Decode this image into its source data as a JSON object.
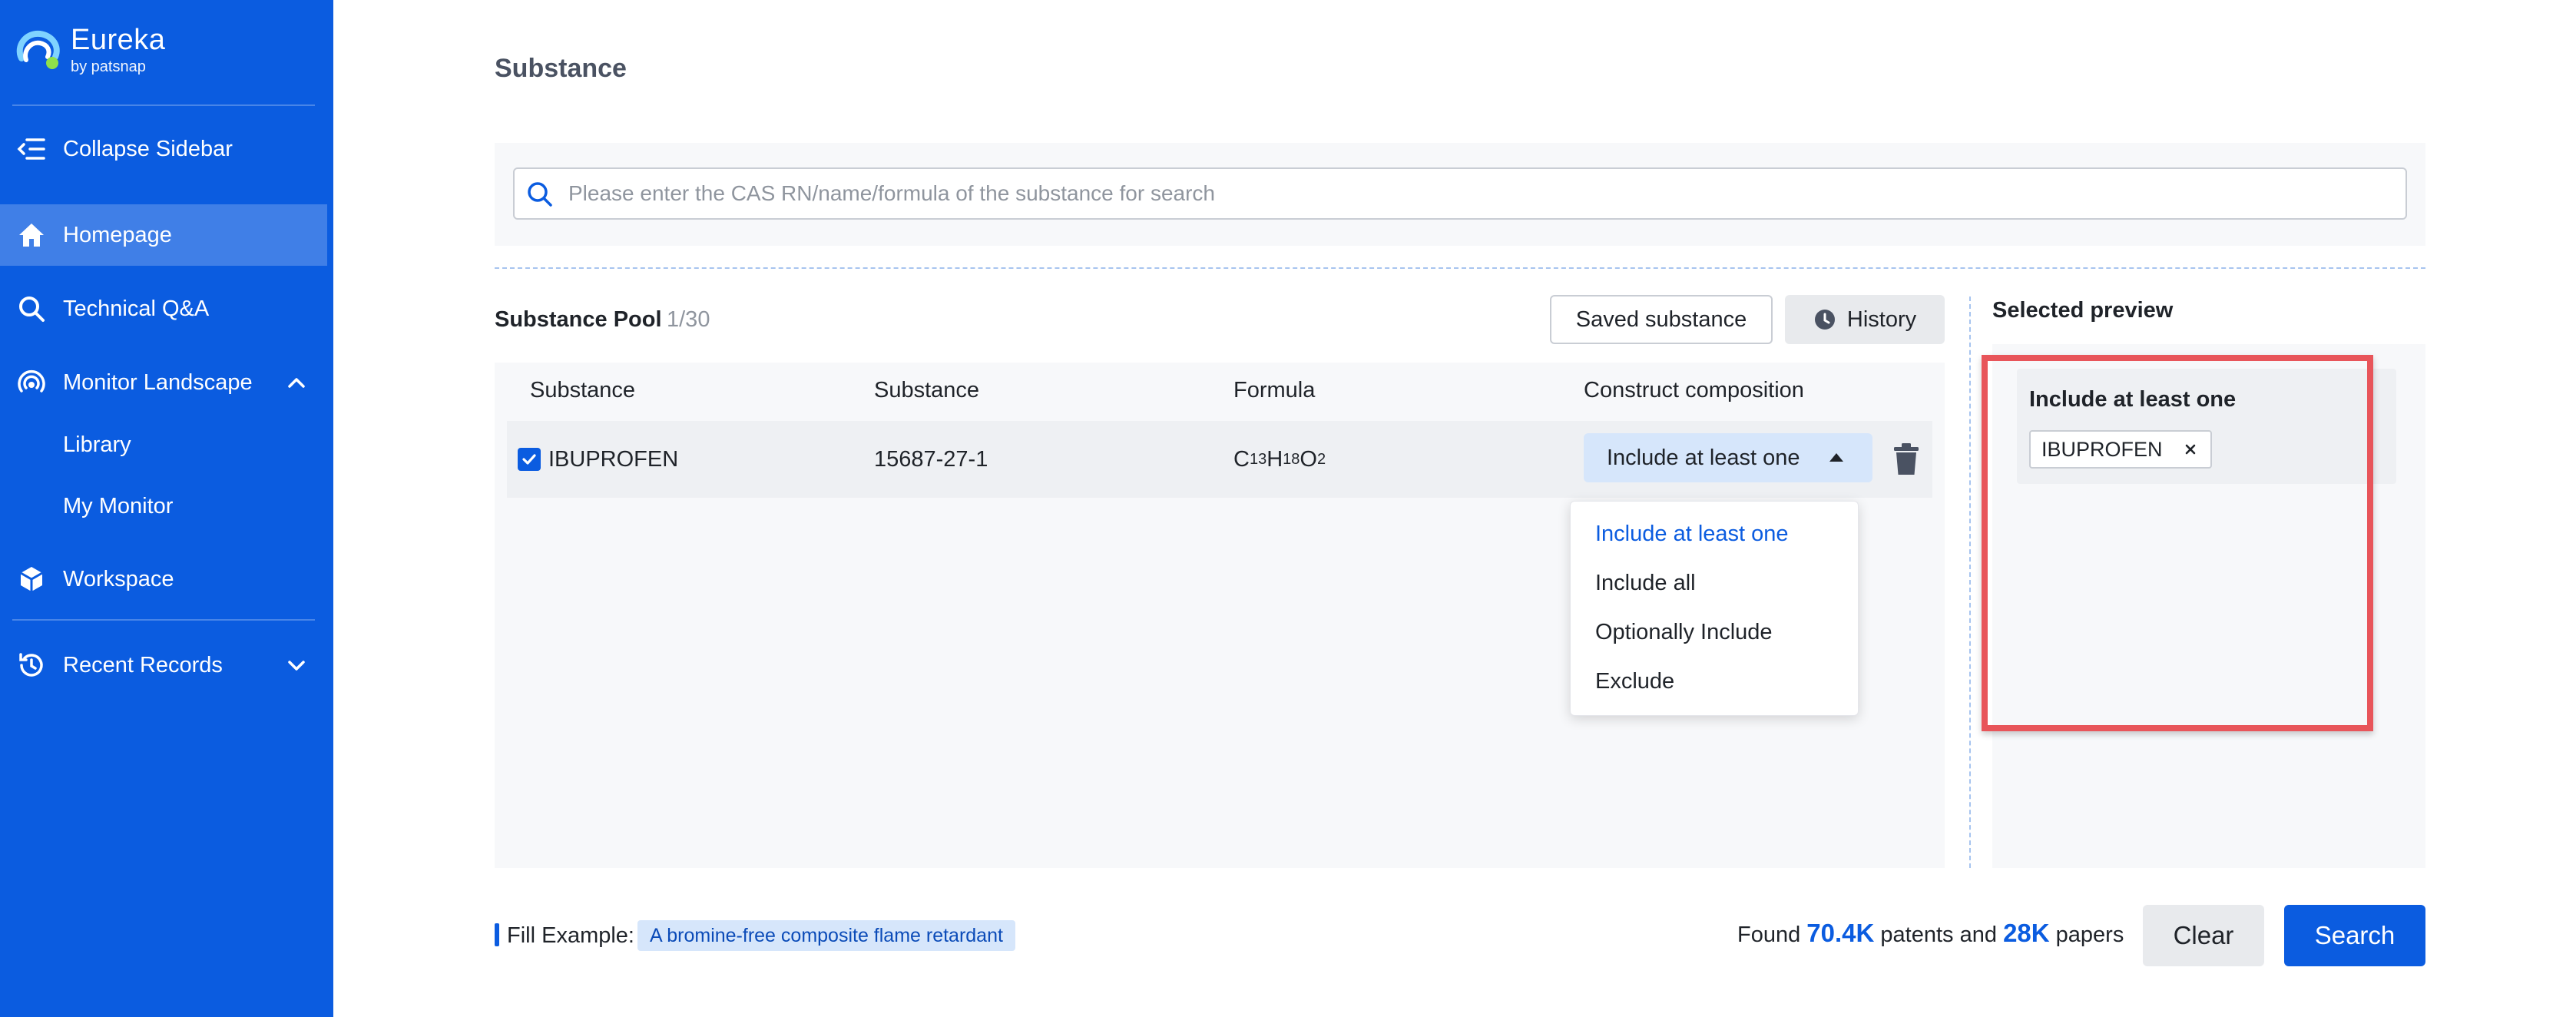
{
  "sidebar": {
    "brand": {
      "name": "Eureka",
      "sub": "by patsnap",
      "icon": "eureka-logo-icon"
    },
    "collapse_label": "Collapse Sidebar",
    "items": [
      {
        "label": "Homepage",
        "icon": "home-icon",
        "active": true
      },
      {
        "label": "Technical Q&A",
        "icon": "search-icon"
      },
      {
        "label": "Monitor Landscape",
        "icon": "monitor-radar-icon",
        "expanded": true,
        "children": [
          {
            "label": "Library"
          },
          {
            "label": "My Monitor"
          }
        ]
      },
      {
        "label": "Workspace",
        "icon": "cube-icon"
      },
      {
        "label": "Recent Records",
        "icon": "history-icon",
        "expanded": false
      }
    ]
  },
  "page": {
    "title": "Substance"
  },
  "search": {
    "placeholder": "Please enter the CAS RN/name/formula of the substance for search",
    "value": ""
  },
  "pool": {
    "title": "Substance Pool",
    "count": "1/30",
    "saved_button": "Saved substance",
    "history_button": "History",
    "columns": [
      "Substance",
      "Substance",
      "Formula",
      "Construct composition"
    ],
    "rows": [
      {
        "checked": true,
        "name": "IBUPROFEN",
        "cas": "15687-27-1",
        "formula": {
          "parts": [
            "C",
            "13",
            "H",
            "18",
            "O",
            "2"
          ]
        },
        "composition": "Include at least one"
      }
    ],
    "dropdown_options": [
      "Include at least one",
      "Include all",
      "Optionally Include",
      "Exclude"
    ],
    "dropdown_selected_index": 0
  },
  "preview": {
    "title": "Selected preview",
    "groups": [
      {
        "title": "Include at least one",
        "tags": [
          "IBUPROFEN"
        ]
      }
    ]
  },
  "footer": {
    "fill_label": "Fill Example:",
    "fill_example": "A bromine-free composite flame retardant",
    "found_prefix": "Found",
    "patents": "70.4K",
    "patents_label": "patents and",
    "papers": "28K",
    "papers_label": "papers",
    "clear_button": "Clear",
    "search_button": "Search"
  },
  "colors": {
    "brand": "#0b5ce0",
    "highlight": "#e8555a",
    "panel": "#f7f8fa"
  }
}
